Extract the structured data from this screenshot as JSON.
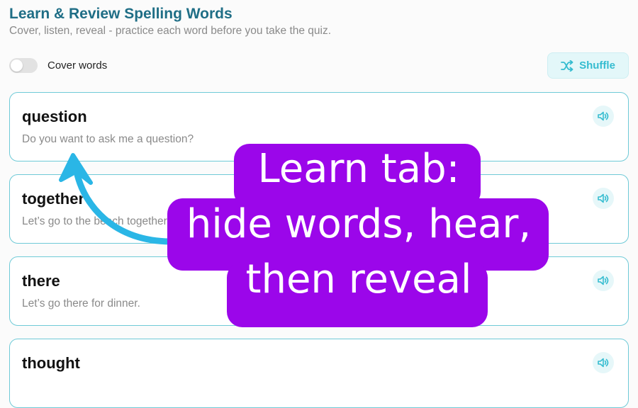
{
  "header": {
    "title": "Learn & Review Spelling Words",
    "subtitle": "Cover, listen, reveal - practice each word before you take the quiz."
  },
  "controls": {
    "cover_toggle_label": "Cover words",
    "cover_toggle_on": false,
    "shuffle_label": "Shuffle"
  },
  "words": [
    {
      "word": "question",
      "sentence": "Do you want to ask me a question?"
    },
    {
      "word": "together",
      "sentence": "Let’s go to the beach together."
    },
    {
      "word": "there",
      "sentence": "Let’s go there for dinner."
    },
    {
      "word": "thought",
      "sentence": ""
    }
  ],
  "callout": {
    "line1": "Learn tab:",
    "line2": "hide words, hear,",
    "line3": "then reveal"
  },
  "colors": {
    "title": "#1f6e86",
    "accent": "#35bcd0",
    "card_border": "#6fcad7",
    "callout_bg": "#9b06ea",
    "arrow": "#2ab6e6"
  }
}
